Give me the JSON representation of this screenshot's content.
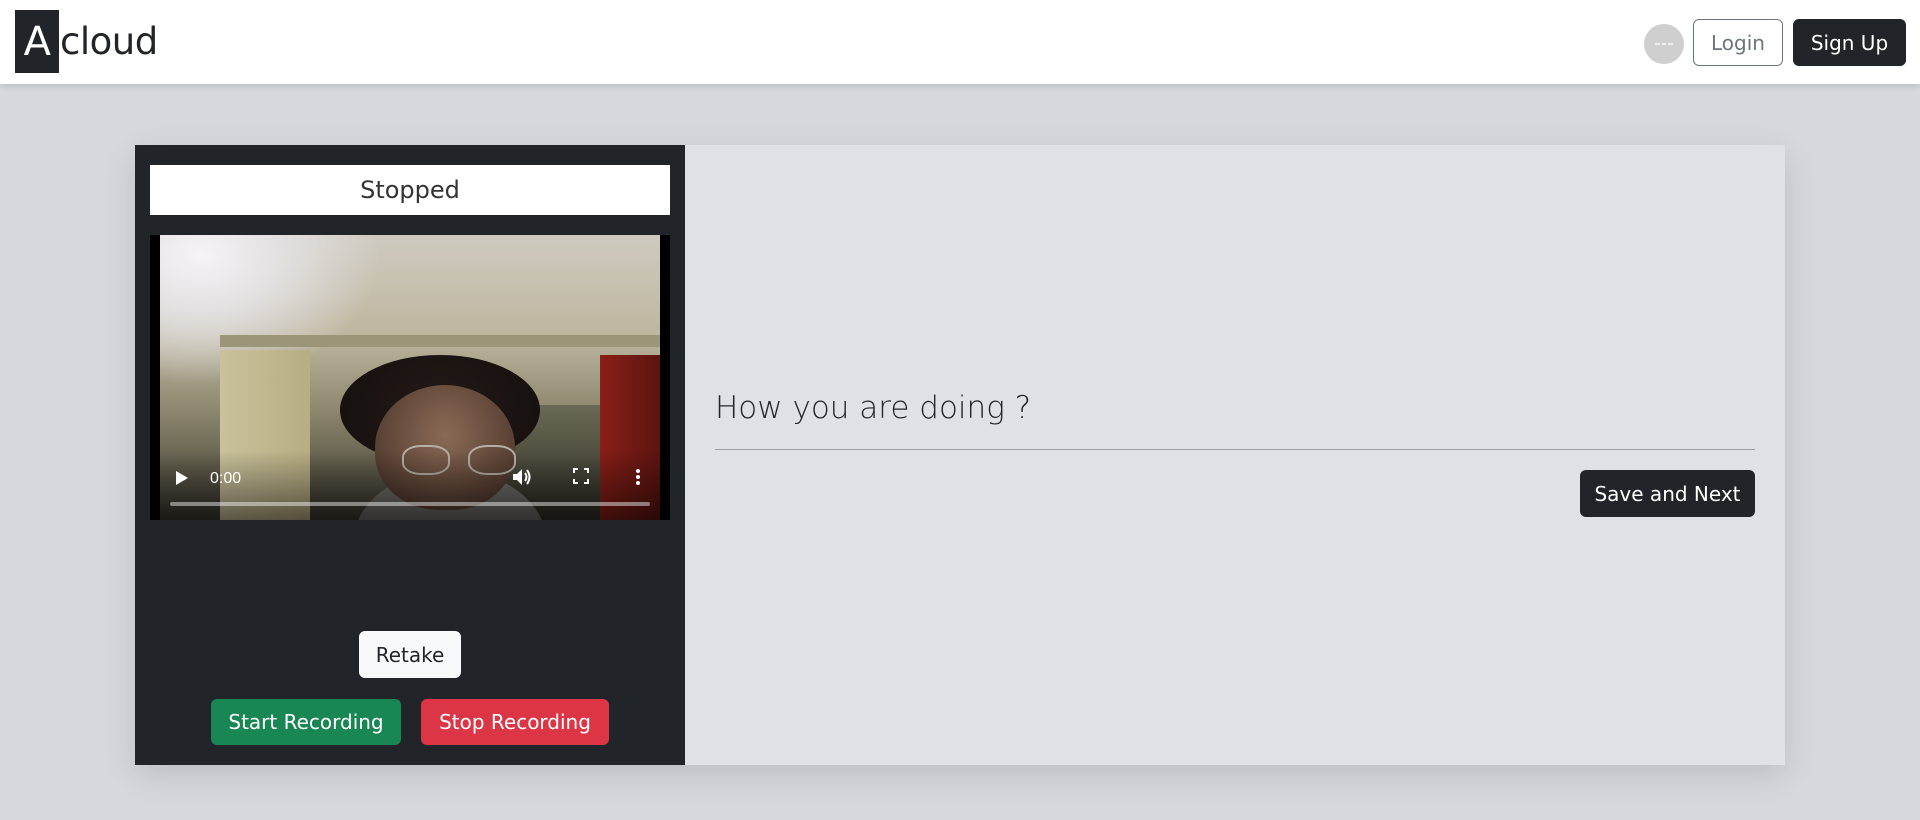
{
  "navbar": {
    "logo_letter": "A",
    "logo_rest": "cloud",
    "login_label": "Login",
    "signup_label": "Sign Up"
  },
  "recorder": {
    "status": "Stopped",
    "video": {
      "current_time": "0:00",
      "progress": 0
    },
    "retake_label": "Retake",
    "start_label": "Start Recording",
    "stop_label": "Stop Recording"
  },
  "question_panel": {
    "question": "How you are doing ?",
    "save_next_label": "Save and Next"
  },
  "icons": {
    "play": "play-icon",
    "volume": "volume-icon",
    "fullscreen": "fullscreen-icon",
    "more": "more-options-icon"
  },
  "colors": {
    "dark": "#212529",
    "success": "#198754",
    "danger": "#dc3545",
    "light": "#f8f9fa",
    "panel": "#dee1e6"
  }
}
